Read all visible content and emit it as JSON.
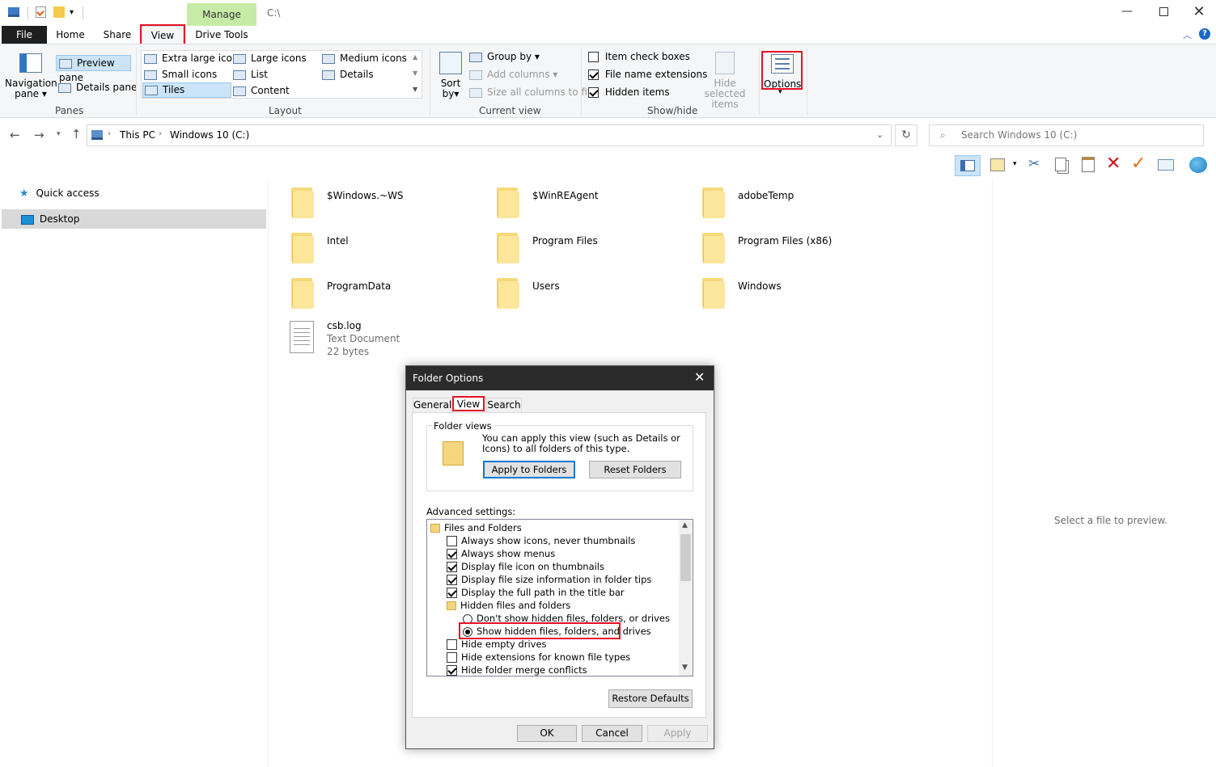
{
  "titlebar": {
    "manage_tab": "Manage",
    "path_title": "C:\\"
  },
  "ribbon_tabs": [
    "File",
    "Home",
    "Share",
    "View",
    "Drive Tools"
  ],
  "ribbon": {
    "panes": {
      "navigation_pane": "Navigation",
      "navigation_pane2": "pane",
      "preview_pane": "Preview pane",
      "details_pane": "Details pane",
      "group_label": "Panes"
    },
    "layout": {
      "items": [
        "Extra large icons",
        "Large icons",
        "Medium icons",
        "Small icons",
        "List",
        "Details",
        "Tiles",
        "Content"
      ],
      "group_label": "Layout"
    },
    "current_view": {
      "sort_by": "Sort",
      "sort_by2": "by",
      "group_by": "Group by",
      "add_columns": "Add columns",
      "size_columns": "Size all columns to fit",
      "group_label": "Current view"
    },
    "show_hide": {
      "item_check_boxes": "Item check boxes",
      "file_name_extensions": "File name extensions",
      "hidden_items": "Hidden items",
      "hide_selected": "Hide selected",
      "hide_selected2": "items",
      "group_label": "Show/hide"
    },
    "options": "Options"
  },
  "address_bar": {
    "crumbs": [
      "This PC",
      "Windows 10 (C:)"
    ],
    "search_placeholder": "Search Windows 10 (C:)"
  },
  "nav_pane": {
    "items": [
      "Quick access",
      "Desktop"
    ]
  },
  "files": [
    {
      "name": "$Windows.~WS"
    },
    {
      "name": "$WinREAgent"
    },
    {
      "name": "adobeTemp"
    },
    {
      "name": "Intel"
    },
    {
      "name": "Program Files"
    },
    {
      "name": "Program Files (x86)"
    },
    {
      "name": "ProgramData"
    },
    {
      "name": "Users"
    },
    {
      "name": "Windows"
    }
  ],
  "file_doc": {
    "name": "csb.log",
    "type": "Text Document",
    "size": "22 bytes"
  },
  "preview_text": "Select a file to preview.",
  "dialog": {
    "title": "Folder Options",
    "tabs": [
      "General",
      "View",
      "Search"
    ],
    "folder_views_label": "Folder views",
    "folder_views_desc": "You can apply this view (such as Details or Icons) to all folders of this type.",
    "apply_to_folders": "Apply to Folders",
    "reset_folders": "Reset Folders",
    "advanced_label": "Advanced settings:",
    "tree": [
      {
        "label": "Files and Folders",
        "kind": "folder",
        "indent": 0
      },
      {
        "label": "Always show icons, never thumbnails",
        "kind": "check",
        "checked": false,
        "indent": 1
      },
      {
        "label": "Always show menus",
        "kind": "check",
        "checked": true,
        "indent": 1
      },
      {
        "label": "Display file icon on thumbnails",
        "kind": "check",
        "checked": true,
        "indent": 1
      },
      {
        "label": "Display file size information in folder tips",
        "kind": "check",
        "checked": true,
        "indent": 1
      },
      {
        "label": "Display the full path in the title bar",
        "kind": "check",
        "checked": true,
        "indent": 1
      },
      {
        "label": "Hidden files and folders",
        "kind": "folder",
        "indent": 1
      },
      {
        "label": "Don't show hidden files, folders, or drives",
        "kind": "radio",
        "checked": false,
        "indent": 2
      },
      {
        "label": "Show hidden files, folders, and drives",
        "kind": "radio",
        "checked": true,
        "indent": 2
      },
      {
        "label": "Hide empty drives",
        "kind": "check",
        "checked": false,
        "indent": 1
      },
      {
        "label": "Hide extensions for known file types",
        "kind": "check",
        "checked": false,
        "indent": 1
      },
      {
        "label": "Hide folder merge conflicts",
        "kind": "check",
        "checked": true,
        "indent": 1
      }
    ],
    "restore_defaults": "Restore Defaults",
    "ok": "OK",
    "cancel": "Cancel",
    "apply": "Apply"
  }
}
